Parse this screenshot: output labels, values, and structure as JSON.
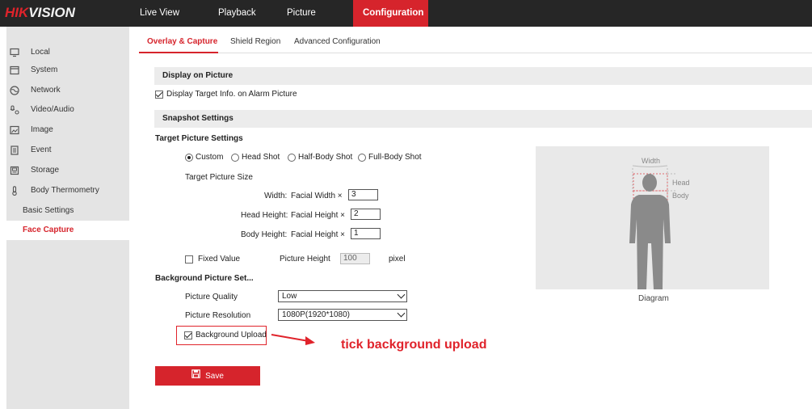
{
  "brand": {
    "logo_red": "HIK",
    "logo_white": "VISION"
  },
  "nav": [
    "Live View",
    "Playback",
    "Picture",
    "Configuration"
  ],
  "sidebar": {
    "items": [
      {
        "label": "Local",
        "icon": "monitor-icon"
      },
      {
        "label": "System",
        "icon": "system-icon"
      },
      {
        "label": "Network",
        "icon": "globe-icon"
      },
      {
        "label": "Video/Audio",
        "icon": "video-audio-icon"
      },
      {
        "label": "Image",
        "icon": "image-icon"
      },
      {
        "label": "Event",
        "icon": "event-icon"
      },
      {
        "label": "Storage",
        "icon": "storage-icon"
      },
      {
        "label": "Body Thermometry",
        "icon": "thermometer-icon"
      }
    ],
    "subitems": [
      "Basic Settings",
      "Face Capture"
    ]
  },
  "tabs": [
    "Overlay & Capture",
    "Shield Region",
    "Advanced Configuration"
  ],
  "display_on_picture": {
    "header": "Display on Picture",
    "checkbox_label": "Display Target Info. on Alarm Picture",
    "checked": true
  },
  "snapshot": {
    "header": "Snapshot Settings",
    "target_picture_settings": "Target Picture Settings",
    "options": [
      "Custom",
      "Head Shot",
      "Half-Body Shot",
      "Full-Body Shot"
    ],
    "selected_option": "Custom",
    "target_picture_size": "Target Picture Size",
    "width_label": "Width:",
    "width_unit": "Facial Width ×",
    "width_value": "3",
    "head_label": "Head Height:",
    "head_unit": "Facial Height ×",
    "head_value": "2",
    "body_label": "Body Height:",
    "body_unit": "Facial Height ×",
    "body_value": "1",
    "fixed_value_label": "Fixed Value",
    "fixed_value_checked": false,
    "picture_height_label": "Picture Height",
    "picture_height_value": "100",
    "pixel_unit": "pixel"
  },
  "background": {
    "header": "Background Picture Set...",
    "quality_label": "Picture Quality",
    "quality_value": "Low",
    "resolution_label": "Picture Resolution",
    "resolution_value": "1080P(1920*1080)",
    "upload_label": "Background Upload",
    "upload_checked": true
  },
  "annotation": "tick background upload",
  "save_label": "Save",
  "diagram": {
    "width_label": "Width",
    "head_label": "Head",
    "body_label": "Body",
    "caption": "Diagram"
  },
  "colors": {
    "accent": "#d6242c",
    "topbar": "#262626",
    "sidebar": "#e4e4e4"
  }
}
